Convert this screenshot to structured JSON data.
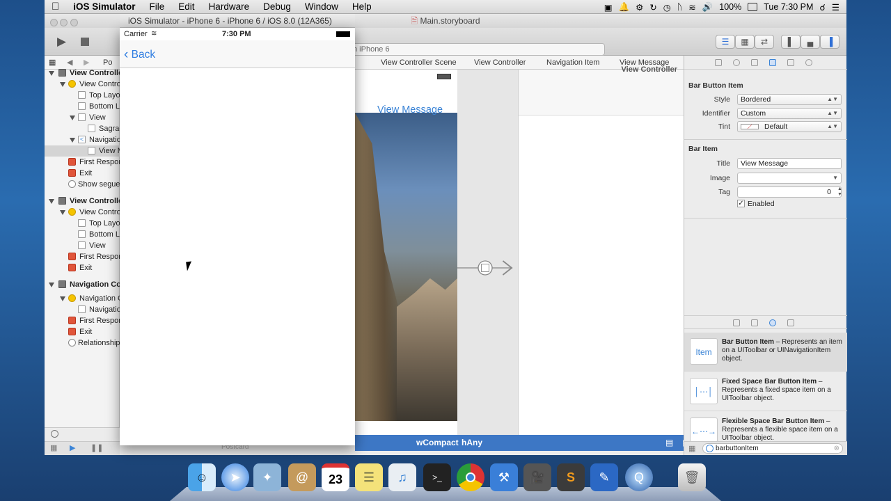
{
  "menubar": {
    "apple": "",
    "app_name": "iOS Simulator",
    "items": [
      "File",
      "Edit",
      "Hardware",
      "Debug",
      "Window",
      "Help"
    ],
    "battery": "100%",
    "clock": "Tue 7:30 PM"
  },
  "xcode": {
    "window_title": "Main.storyboard",
    "scheme_text": "n iPhone 6",
    "jumpbar": [
      "Po",
      "View Controller Scene",
      "View Controller",
      "Navigation Item",
      "View Message"
    ],
    "navigator": {
      "rows": [
        {
          "label": "View Controlle",
          "bold": true
        },
        {
          "label": "View Contro"
        },
        {
          "label": "Top Layo"
        },
        {
          "label": "Bottom L"
        },
        {
          "label": "View"
        },
        {
          "label": "Sagrad"
        },
        {
          "label": "Navigatio"
        },
        {
          "label": "View M"
        },
        {
          "label": "First Respon"
        },
        {
          "label": "Exit"
        },
        {
          "label": "Show segue"
        },
        {
          "label": "View Controlle",
          "bold": true
        },
        {
          "label": "View Contro"
        },
        {
          "label": "Top Layo"
        },
        {
          "label": "Bottom L"
        },
        {
          "label": "View"
        },
        {
          "label": "First Respon"
        },
        {
          "label": "Exit"
        },
        {
          "label": "Navigation Co",
          "bold": true
        },
        {
          "label": "Navigation C"
        },
        {
          "label": "Navigatio"
        },
        {
          "label": "First Respon"
        },
        {
          "label": "Exit"
        },
        {
          "label": "Relationship"
        }
      ]
    },
    "canvas": {
      "vc_button": "View Message",
      "vc2_title": "View Controller",
      "size_class_w": "wCompact",
      "size_class_h": "hAny",
      "bottom_label": "Postcard"
    },
    "inspector": {
      "bar_button_section": "Bar Button Item",
      "style_label": "Style",
      "style_value": "Bordered",
      "identifier_label": "Identifier",
      "identifier_value": "Custom",
      "tint_label": "Tint",
      "tint_value": "Default",
      "bar_item_section": "Bar Item",
      "title_label": "Title",
      "title_value": "View Message",
      "image_label": "Image",
      "image_value": "",
      "tag_label": "Tag",
      "tag_value": "0",
      "enabled_label": "Enabled"
    },
    "library": {
      "items": [
        {
          "icon_text": "Item",
          "name": "Bar Button Item",
          "desc": " – Represents an item on a UIToolbar or UINavigationItem object."
        },
        {
          "icon_text": "",
          "name": "Fixed Space Bar Button Item",
          "desc": " – Represents a fixed space item on a UIToolbar object."
        },
        {
          "icon_text": "",
          "name": "Flexible Space Bar Button Item",
          "desc": " – Represents a flexible space item on a UIToolbar object."
        }
      ],
      "filter_value": "barbuttonItem"
    }
  },
  "simulator": {
    "title": "iOS Simulator - iPhone 6 - iPhone 6 / iOS 8.0 (12A365)",
    "carrier": "Carrier",
    "time": "7:30 PM",
    "back_label": "Back"
  },
  "dock": {
    "apps": [
      "finder-icon",
      "safari-icon",
      "preview-icon",
      "contacts-icon",
      "calendar-icon",
      "stickies-icon",
      "itunes-icon",
      "terminal-icon",
      "chrome-icon",
      "xcode-icon",
      "dvd-icon",
      "sublime-icon",
      "instruments-icon",
      "quicktime-icon",
      "trash-icon"
    ],
    "calendar_day": "23"
  },
  "colors": {
    "ios_tint": "#2f7de1",
    "size_bar": "#3d77c5"
  }
}
